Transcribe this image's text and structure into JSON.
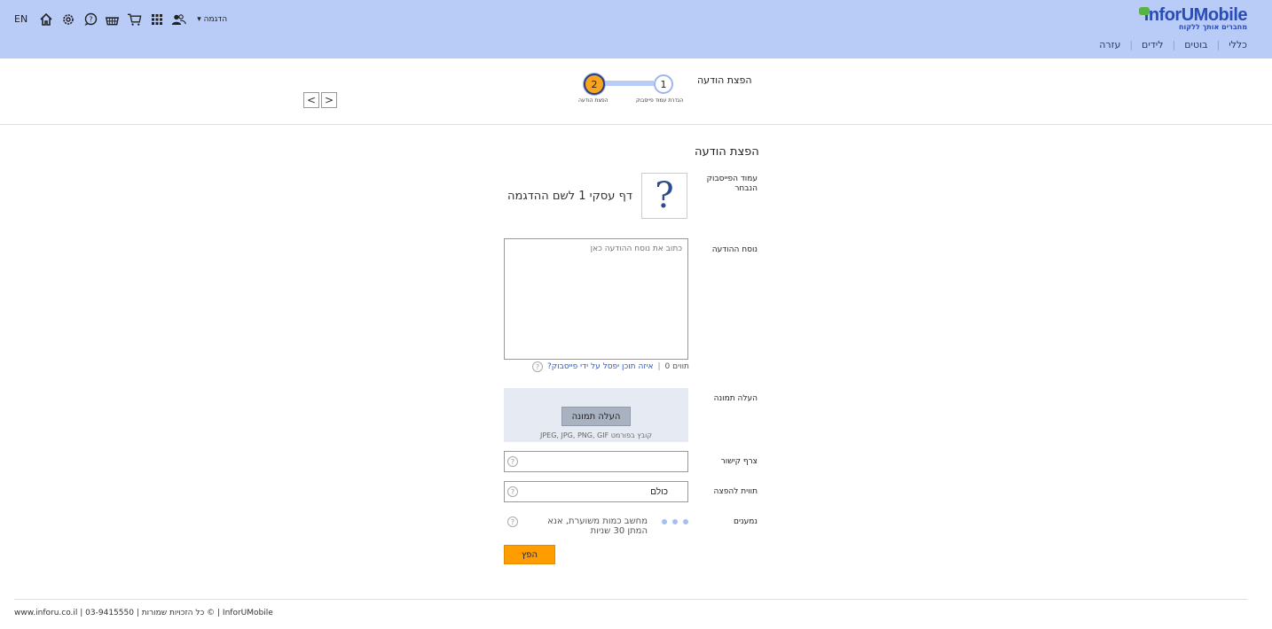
{
  "header": {
    "brand_prefix": "Infor",
    "brand_suffix": "UMobile",
    "tagline": "מחברים אותך ללקוח",
    "nav": [
      "כללי",
      "בוטים",
      "לידים",
      "עזרה"
    ],
    "account_label": "הדגמה",
    "lang_label": "EN",
    "icons": [
      "home-icon",
      "gear-icon",
      "chat-icon",
      "basket-icon",
      "cart-icon",
      "apps-grid-icon",
      "users-icon"
    ]
  },
  "wizard": {
    "title": "הפצת הודעה",
    "steps": [
      {
        "number": "1",
        "label": "הגדרת עמוד פייסבוק"
      },
      {
        "number": "2",
        "label": "הפצת הודעה"
      }
    ],
    "current_step": 2,
    "prev_label": "<",
    "next_label": ">"
  },
  "form": {
    "section_title": "הפצת הודעה",
    "page_label": "עמוד הפייסבוק הנבחר",
    "page_icon_glyph": "?",
    "page_name": "דף עסקי 1 לשם ההדגמה",
    "message_label": "נוסח ההודעה",
    "message_placeholder": "כתוב את נוסח ההודעה כאן",
    "char_count": "תווים 0",
    "separator": "|",
    "rejected_link": "איזה תוכן יפסל על ידי פייסבוק?",
    "upload_label": "העלה תמונה",
    "upload_button": "העלה תמונה",
    "upload_formats": "קובץ בפורמט JPEG, JPG, PNG, GIF",
    "link_label": "צרף קישור",
    "link_value": "",
    "tag_label": "תווית להפצה",
    "tag_value": "כולם",
    "recipients_label": "נמענים",
    "recipients_status": "מחשב כמות משוערת, אנא המתן 30 שניות",
    "help_glyph": "?",
    "submit_button": "הפץ"
  },
  "footer": {
    "text": "www.inforu.co.il | 03-9415550 | כל הזכויות שמורות © | InforUMobile"
  }
}
